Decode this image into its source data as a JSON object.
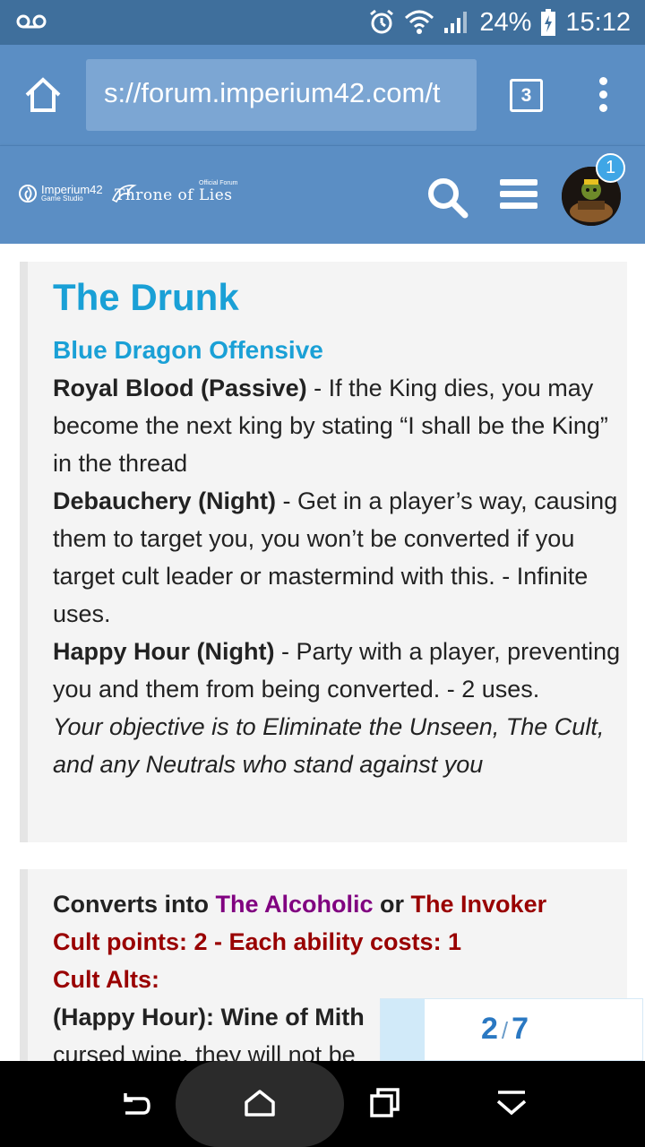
{
  "status_bar": {
    "battery": "24%",
    "time": "15:12",
    "icons": [
      "voicemail-icon",
      "alarm-icon",
      "wifi-icon",
      "signal-icon",
      "battery-charging-icon"
    ]
  },
  "browser": {
    "url": "s://forum.imperium42.com/t",
    "tab_count": "3"
  },
  "forum_header": {
    "studio_logo_line1": "Imperium42",
    "studio_logo_line2": "Game Studio",
    "official_label": "Official Forum",
    "game_logo": "Throne of Lies",
    "notification_count": "1"
  },
  "post": {
    "title": "The Drunk",
    "faction": "Blue Dragon Offensive",
    "abilities": [
      {
        "name": "Royal Blood (Passive)",
        "text": " - If the King dies, you may become the next king by stating “I shall be the King” in the thread"
      },
      {
        "name": "Debauchery (Night)",
        "text": " - Get in a player’s way, causing them to target you, you won’t be converted if you target cult leader or mastermind with this. - Infinite uses."
      },
      {
        "name": "Happy Hour (Night)",
        "text": " - Party with a player, preventing you and them from being converted. - 2 uses."
      }
    ],
    "objective": "Your objective is to Eliminate the Unseen, The Cult, and any Neutrals who stand against you"
  },
  "conversion": {
    "prefix": "Converts into ",
    "option1": "The Alcoholic",
    "joiner": " or ",
    "option2": "The Invoker",
    "cult_points": "Cult points: 2 - Each ability costs: 1",
    "cult_alts": "Cult Alts:",
    "alt1_name": "(Happy Hour): Wine of Mith",
    "alt1_cont": "cursed wine, they will not be"
  },
  "progress": {
    "current": "2",
    "separator": "/",
    "total": "7",
    "fraction": 0.1667
  },
  "colors": {
    "status_bar": "#3f6f9c",
    "browser_bar": "#5b8ec4",
    "title_blue": "#1aa0d6",
    "purple": "#800080",
    "dark_red": "#990000"
  }
}
